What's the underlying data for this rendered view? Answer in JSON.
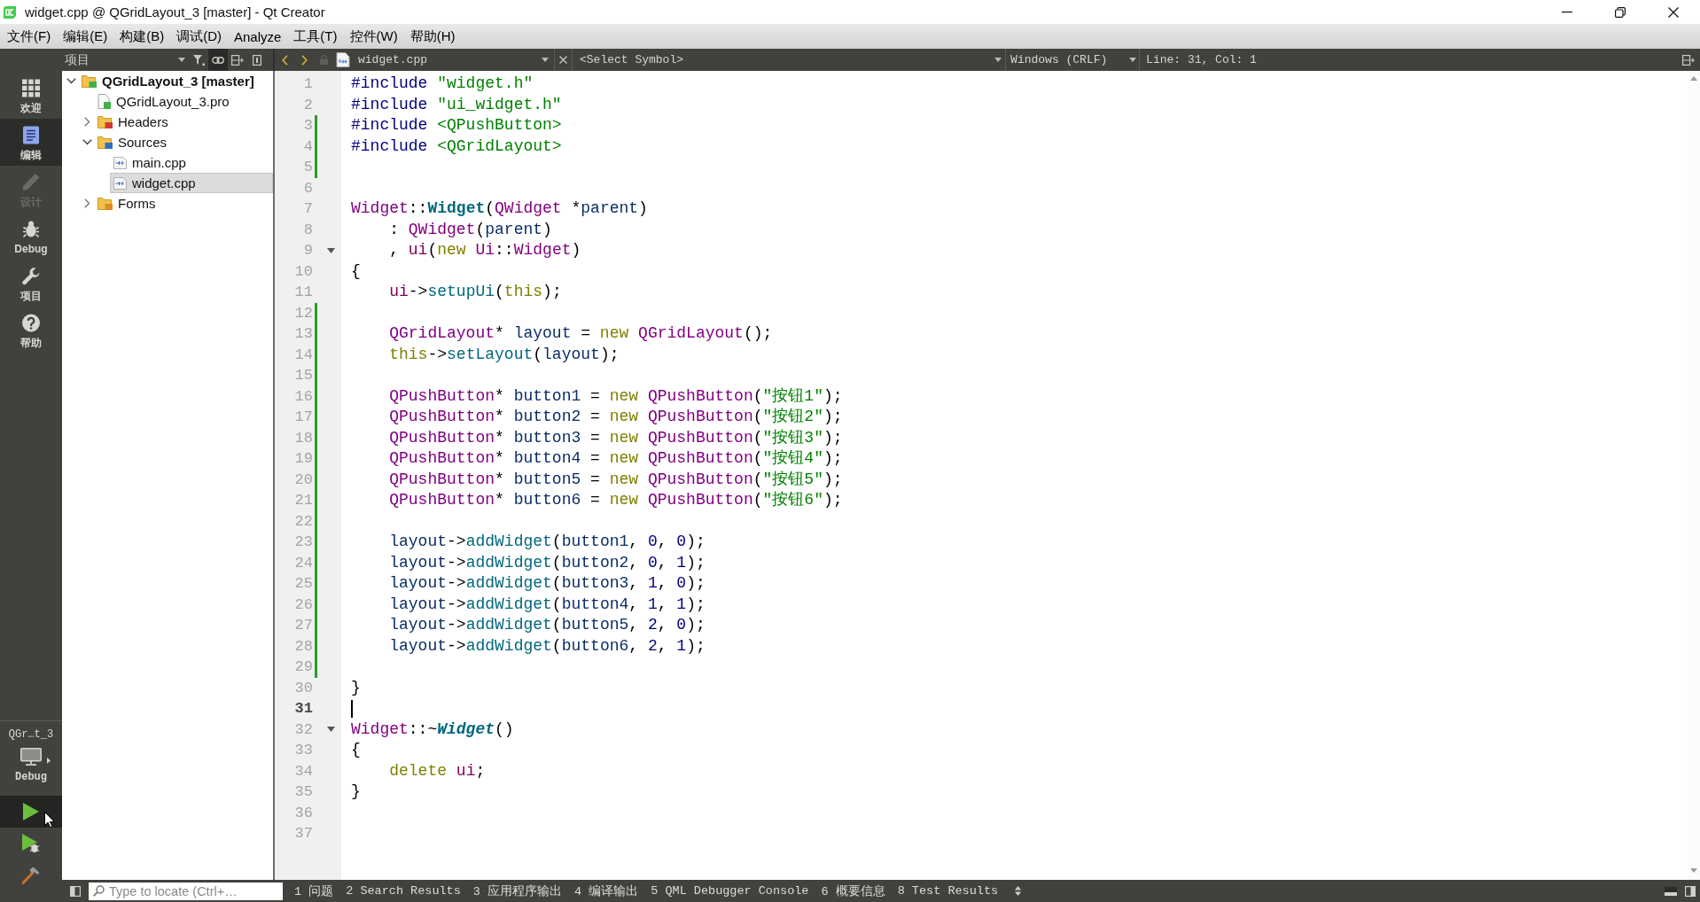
{
  "window": {
    "title": "widget.cpp @ QGridLayout_3 [master] - Qt Creator"
  },
  "menu": [
    "文件(F)",
    "编辑(E)",
    "构建(B)",
    "调试(D)",
    "Analyze",
    "工具(T)",
    "控件(W)",
    "帮助(H)"
  ],
  "mode_bar": {
    "modes": [
      {
        "label": "欢迎",
        "kind": "welcome",
        "selected": false,
        "disabled": false
      },
      {
        "label": "编辑",
        "kind": "edit",
        "selected": true,
        "disabled": false
      },
      {
        "label": "设计",
        "kind": "design",
        "selected": false,
        "disabled": true
      },
      {
        "label": "Debug",
        "kind": "debug",
        "selected": false,
        "disabled": false
      },
      {
        "label": "项目",
        "kind": "projects",
        "selected": false,
        "disabled": false
      },
      {
        "label": "帮助",
        "kind": "help",
        "selected": false,
        "disabled": false
      }
    ],
    "kit": {
      "project": "QGr…t_3",
      "build": "Debug"
    },
    "actions": [
      {
        "kind": "run",
        "highlighted": true
      },
      {
        "kind": "debug-run",
        "highlighted": false
      },
      {
        "kind": "build",
        "highlighted": false
      }
    ]
  },
  "navigation": {
    "title": "项目",
    "sync_on": true,
    "tree": [
      {
        "label": "QGridLayout_3 [master]",
        "kind": "project",
        "expanded": true,
        "selected": false,
        "children": [
          {
            "label": "QGridLayout_3.pro",
            "kind": "pro-file",
            "selected": false
          },
          {
            "label": "Headers",
            "kind": "header-folder",
            "expanded": false,
            "selected": false
          },
          {
            "label": "Sources",
            "kind": "source-folder",
            "expanded": true,
            "selected": false,
            "children": [
              {
                "label": "main.cpp",
                "kind": "cpp-file",
                "selected": false
              },
              {
                "label": "widget.cpp",
                "kind": "cpp-file",
                "selected": true
              }
            ]
          },
          {
            "label": "Forms",
            "kind": "form-folder",
            "expanded": false,
            "selected": false
          }
        ]
      }
    ]
  },
  "editor": {
    "file": "widget.cpp",
    "symbol": "<Select Symbol>",
    "line_ending": "Windows (CRLF)",
    "cursor_position": "Line: 31, Col: 1",
    "lines": [
      {
        "number": "1",
        "changed": false,
        "fold": false,
        "current": false,
        "tokens": [
          {
            "kind": "preprocessor",
            "text": "#include "
          },
          {
            "kind": "string",
            "text": "\"widget.h\""
          }
        ]
      },
      {
        "number": "2",
        "changed": false,
        "fold": false,
        "current": false,
        "tokens": [
          {
            "kind": "preprocessor",
            "text": "#include "
          },
          {
            "kind": "string",
            "text": "\"ui_widget.h\""
          }
        ]
      },
      {
        "number": "3",
        "changed": true,
        "fold": false,
        "current": false,
        "tokens": [
          {
            "kind": "preprocessor",
            "text": "#include "
          },
          {
            "kind": "string",
            "text": "<QPushButton>"
          }
        ]
      },
      {
        "number": "4",
        "changed": true,
        "fold": false,
        "current": false,
        "tokens": [
          {
            "kind": "preprocessor",
            "text": "#include "
          },
          {
            "kind": "string",
            "text": "<QGridLayout>"
          }
        ]
      },
      {
        "number": "5",
        "changed": true,
        "fold": false,
        "current": false
      },
      {
        "number": "6",
        "changed": false,
        "fold": false,
        "current": false
      },
      {
        "number": "7",
        "changed": false,
        "fold": false,
        "current": false,
        "tokens": [
          {
            "kind": "type",
            "text": "Widget"
          },
          {
            "kind": "plain",
            "text": "::"
          },
          {
            "kind": "declaration",
            "text": "Widget"
          },
          {
            "kind": "plain",
            "text": "("
          },
          {
            "kind": "type",
            "text": "QWidget"
          },
          {
            "kind": "plain",
            "text": " *"
          },
          {
            "kind": "local",
            "text": "parent"
          },
          {
            "kind": "plain",
            "text": ")"
          }
        ]
      },
      {
        "number": "8",
        "changed": false,
        "fold": false,
        "current": false,
        "tokens": [
          {
            "kind": "plain",
            "text": "    : "
          },
          {
            "kind": "type",
            "text": "QWidget"
          },
          {
            "kind": "plain",
            "text": "("
          },
          {
            "kind": "local",
            "text": "parent"
          },
          {
            "kind": "plain",
            "text": ")"
          }
        ]
      },
      {
        "number": "9",
        "changed": false,
        "fold": true,
        "current": false,
        "tokens": [
          {
            "kind": "plain",
            "text": "    , "
          },
          {
            "kind": "field",
            "text": "ui"
          },
          {
            "kind": "plain",
            "text": "("
          },
          {
            "kind": "keyword",
            "text": "new "
          },
          {
            "kind": "type",
            "text": "Ui"
          },
          {
            "kind": "plain",
            "text": "::"
          },
          {
            "kind": "type",
            "text": "Widget"
          },
          {
            "kind": "plain",
            "text": ")"
          }
        ]
      },
      {
        "number": "10",
        "changed": false,
        "fold": false,
        "current": false,
        "tokens": [
          {
            "kind": "plain",
            "text": "{"
          }
        ]
      },
      {
        "number": "11",
        "changed": false,
        "fold": false,
        "current": false,
        "tokens": [
          {
            "kind": "field",
            "text": "    ui"
          },
          {
            "kind": "plain",
            "text": "->"
          },
          {
            "kind": "function",
            "text": "setupUi"
          },
          {
            "kind": "plain",
            "text": "("
          },
          {
            "kind": "keyword",
            "text": "this"
          },
          {
            "kind": "plain",
            "text": ");"
          }
        ]
      },
      {
        "number": "12",
        "changed": true,
        "fold": false,
        "current": false
      },
      {
        "number": "13",
        "changed": true,
        "fold": false,
        "current": false,
        "tokens": [
          {
            "kind": "type",
            "text": "    QGridLayout"
          },
          {
            "kind": "plain",
            "text": "* "
          },
          {
            "kind": "local",
            "text": "layout"
          },
          {
            "kind": "plain",
            "text": " = "
          },
          {
            "kind": "keyword",
            "text": "new "
          },
          {
            "kind": "type",
            "text": "QGridLayout"
          },
          {
            "kind": "plain",
            "text": "();"
          }
        ]
      },
      {
        "number": "14",
        "changed": true,
        "fold": false,
        "current": false,
        "tokens": [
          {
            "kind": "keyword",
            "text": "    this"
          },
          {
            "kind": "plain",
            "text": "->"
          },
          {
            "kind": "function",
            "text": "setLayout"
          },
          {
            "kind": "plain",
            "text": "("
          },
          {
            "kind": "local",
            "text": "layout"
          },
          {
            "kind": "plain",
            "text": ");"
          }
        ]
      },
      {
        "number": "15",
        "changed": true,
        "fold": false,
        "current": false
      },
      {
        "number": "16",
        "changed": true,
        "fold": false,
        "current": false,
        "tokens": [
          {
            "kind": "type",
            "text": "    QPushButton"
          },
          {
            "kind": "plain",
            "text": "* "
          },
          {
            "kind": "local",
            "text": "button1"
          },
          {
            "kind": "plain",
            "text": " = "
          },
          {
            "kind": "keyword",
            "text": "new "
          },
          {
            "kind": "type",
            "text": "QPushButton"
          },
          {
            "kind": "plain",
            "text": "("
          },
          {
            "kind": "string",
            "text": "\"按钮1\""
          },
          {
            "kind": "plain",
            "text": ");"
          }
        ]
      },
      {
        "number": "17",
        "changed": true,
        "fold": false,
        "current": false,
        "tokens": [
          {
            "kind": "type",
            "text": "    QPushButton"
          },
          {
            "kind": "plain",
            "text": "* "
          },
          {
            "kind": "local",
            "text": "button2"
          },
          {
            "kind": "plain",
            "text": " = "
          },
          {
            "kind": "keyword",
            "text": "new "
          },
          {
            "kind": "type",
            "text": "QPushButton"
          },
          {
            "kind": "plain",
            "text": "("
          },
          {
            "kind": "string",
            "text": "\"按钮2\""
          },
          {
            "kind": "plain",
            "text": ");"
          }
        ]
      },
      {
        "number": "18",
        "changed": true,
        "fold": false,
        "current": false,
        "tokens": [
          {
            "kind": "type",
            "text": "    QPushButton"
          },
          {
            "kind": "plain",
            "text": "* "
          },
          {
            "kind": "local",
            "text": "button3"
          },
          {
            "kind": "plain",
            "text": " = "
          },
          {
            "kind": "keyword",
            "text": "new "
          },
          {
            "kind": "type",
            "text": "QPushButton"
          },
          {
            "kind": "plain",
            "text": "("
          },
          {
            "kind": "string",
            "text": "\"按钮3\""
          },
          {
            "kind": "plain",
            "text": ");"
          }
        ]
      },
      {
        "number": "19",
        "changed": true,
        "fold": false,
        "current": false,
        "tokens": [
          {
            "kind": "type",
            "text": "    QPushButton"
          },
          {
            "kind": "plain",
            "text": "* "
          },
          {
            "kind": "local",
            "text": "button4"
          },
          {
            "kind": "plain",
            "text": " = "
          },
          {
            "kind": "keyword",
            "text": "new "
          },
          {
            "kind": "type",
            "text": "QPushButton"
          },
          {
            "kind": "plain",
            "text": "("
          },
          {
            "kind": "string",
            "text": "\"按钮4\""
          },
          {
            "kind": "plain",
            "text": ");"
          }
        ]
      },
      {
        "number": "20",
        "changed": true,
        "fold": false,
        "current": false,
        "tokens": [
          {
            "kind": "type",
            "text": "    QPushButton"
          },
          {
            "kind": "plain",
            "text": "* "
          },
          {
            "kind": "local",
            "text": "button5"
          },
          {
            "kind": "plain",
            "text": " = "
          },
          {
            "kind": "keyword",
            "text": "new "
          },
          {
            "kind": "type",
            "text": "QPushButton"
          },
          {
            "kind": "plain",
            "text": "("
          },
          {
            "kind": "string",
            "text": "\"按钮5\""
          },
          {
            "kind": "plain",
            "text": ");"
          }
        ]
      },
      {
        "number": "21",
        "changed": true,
        "fold": false,
        "current": false,
        "tokens": [
          {
            "kind": "type",
            "text": "    QPushButton"
          },
          {
            "kind": "plain",
            "text": "* "
          },
          {
            "kind": "local",
            "text": "button6"
          },
          {
            "kind": "plain",
            "text": " = "
          },
          {
            "kind": "keyword",
            "text": "new "
          },
          {
            "kind": "type",
            "text": "QPushButton"
          },
          {
            "kind": "plain",
            "text": "("
          },
          {
            "kind": "string",
            "text": "\"按钮6\""
          },
          {
            "kind": "plain",
            "text": ");"
          }
        ]
      },
      {
        "number": "22",
        "changed": true,
        "fold": false,
        "current": false
      },
      {
        "number": "23",
        "changed": true,
        "fold": false,
        "current": false,
        "tokens": [
          {
            "kind": "local",
            "text": "    layout"
          },
          {
            "kind": "plain",
            "text": "->"
          },
          {
            "kind": "function",
            "text": "addWidget"
          },
          {
            "kind": "plain",
            "text": "("
          },
          {
            "kind": "local",
            "text": "button1"
          },
          {
            "kind": "plain",
            "text": ", "
          },
          {
            "kind": "number",
            "text": "0"
          },
          {
            "kind": "plain",
            "text": ", "
          },
          {
            "kind": "number",
            "text": "0"
          },
          {
            "kind": "plain",
            "text": ");"
          }
        ]
      },
      {
        "number": "24",
        "changed": true,
        "fold": false,
        "current": false,
        "tokens": [
          {
            "kind": "local",
            "text": "    layout"
          },
          {
            "kind": "plain",
            "text": "->"
          },
          {
            "kind": "function",
            "text": "addWidget"
          },
          {
            "kind": "plain",
            "text": "("
          },
          {
            "kind": "local",
            "text": "button2"
          },
          {
            "kind": "plain",
            "text": ", "
          },
          {
            "kind": "number",
            "text": "0"
          },
          {
            "kind": "plain",
            "text": ", "
          },
          {
            "kind": "number",
            "text": "1"
          },
          {
            "kind": "plain",
            "text": ");"
          }
        ]
      },
      {
        "number": "25",
        "changed": true,
        "fold": false,
        "current": false,
        "tokens": [
          {
            "kind": "local",
            "text": "    layout"
          },
          {
            "kind": "plain",
            "text": "->"
          },
          {
            "kind": "function",
            "text": "addWidget"
          },
          {
            "kind": "plain",
            "text": "("
          },
          {
            "kind": "local",
            "text": "button3"
          },
          {
            "kind": "plain",
            "text": ", "
          },
          {
            "kind": "number",
            "text": "1"
          },
          {
            "kind": "plain",
            "text": ", "
          },
          {
            "kind": "number",
            "text": "0"
          },
          {
            "kind": "plain",
            "text": ");"
          }
        ]
      },
      {
        "number": "26",
        "changed": true,
        "fold": false,
        "current": false,
        "tokens": [
          {
            "kind": "local",
            "text": "    layout"
          },
          {
            "kind": "plain",
            "text": "->"
          },
          {
            "kind": "function",
            "text": "addWidget"
          },
          {
            "kind": "plain",
            "text": "("
          },
          {
            "kind": "local",
            "text": "button4"
          },
          {
            "kind": "plain",
            "text": ", "
          },
          {
            "kind": "number",
            "text": "1"
          },
          {
            "kind": "plain",
            "text": ", "
          },
          {
            "kind": "number",
            "text": "1"
          },
          {
            "kind": "plain",
            "text": ");"
          }
        ]
      },
      {
        "number": "27",
        "changed": true,
        "fold": false,
        "current": false,
        "tokens": [
          {
            "kind": "local",
            "text": "    layout"
          },
          {
            "kind": "plain",
            "text": "->"
          },
          {
            "kind": "function",
            "text": "addWidget"
          },
          {
            "kind": "plain",
            "text": "("
          },
          {
            "kind": "local",
            "text": "button5"
          },
          {
            "kind": "plain",
            "text": ", "
          },
          {
            "kind": "number",
            "text": "2"
          },
          {
            "kind": "plain",
            "text": ", "
          },
          {
            "kind": "number",
            "text": "0"
          },
          {
            "kind": "plain",
            "text": ");"
          }
        ]
      },
      {
        "number": "28",
        "changed": true,
        "fold": false,
        "current": false,
        "tokens": [
          {
            "kind": "local",
            "text": "    layout"
          },
          {
            "kind": "plain",
            "text": "->"
          },
          {
            "kind": "function",
            "text": "addWidget"
          },
          {
            "kind": "plain",
            "text": "("
          },
          {
            "kind": "local",
            "text": "button6"
          },
          {
            "kind": "plain",
            "text": ", "
          },
          {
            "kind": "number",
            "text": "2"
          },
          {
            "kind": "plain",
            "text": ", "
          },
          {
            "kind": "number",
            "text": "1"
          },
          {
            "kind": "plain",
            "text": ");"
          }
        ]
      },
      {
        "number": "29",
        "changed": true,
        "fold": false,
        "current": false
      },
      {
        "number": "30",
        "changed": false,
        "fold": false,
        "current": false,
        "tokens": [
          {
            "kind": "plain",
            "text": "}"
          }
        ]
      },
      {
        "number": "31",
        "changed": false,
        "fold": false,
        "current": true
      },
      {
        "number": "32",
        "changed": false,
        "fold": true,
        "current": false,
        "tokens": [
          {
            "kind": "type",
            "text": "Widget"
          },
          {
            "kind": "plain",
            "text": "::~"
          },
          {
            "kind": "virtual-declaration",
            "text": "Widget"
          },
          {
            "kind": "plain",
            "text": "()"
          }
        ]
      },
      {
        "number": "33",
        "changed": false,
        "fold": false,
        "current": false,
        "tokens": [
          {
            "kind": "plain",
            "text": "{"
          }
        ]
      },
      {
        "number": "34",
        "changed": false,
        "fold": false,
        "current": false,
        "tokens": [
          {
            "kind": "keyword",
            "text": "    delete "
          },
          {
            "kind": "field",
            "text": "ui"
          },
          {
            "kind": "plain",
            "text": ";"
          }
        ]
      },
      {
        "number": "35",
        "changed": false,
        "fold": false,
        "current": false,
        "tokens": [
          {
            "kind": "plain",
            "text": "}"
          }
        ]
      },
      {
        "number": "36",
        "changed": false,
        "fold": false,
        "current": false
      },
      {
        "number": "37",
        "changed": false,
        "fold": false,
        "current": false
      }
    ]
  },
  "status_bar": {
    "locator_placeholder": "Type to locate (Ctrl+…",
    "panes": [
      "1 问题",
      "2 Search Results",
      "3 应用程序输出",
      "4 编译输出",
      "5 QML Debugger Console",
      "6 概要信息",
      "8 Test Results"
    ]
  }
}
